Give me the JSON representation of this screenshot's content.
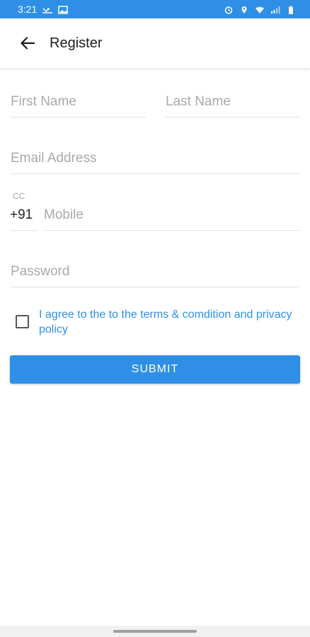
{
  "status_bar": {
    "time": "3:21",
    "left_icons": [
      "missed-call-icon",
      "image-icon"
    ],
    "right_icons": [
      "alarm-icon",
      "location-icon",
      "wifi-icon",
      "signal-icon",
      "battery-icon"
    ]
  },
  "app_bar": {
    "back_icon": "back-arrow-icon",
    "title": "Register"
  },
  "form": {
    "first_name": {
      "placeholder": "First Name",
      "value": ""
    },
    "last_name": {
      "placeholder": "Last Name",
      "value": ""
    },
    "email": {
      "placeholder": "Email Address",
      "value": ""
    },
    "country_code": {
      "label": "CC",
      "value": "+91"
    },
    "mobile": {
      "placeholder": "Mobile",
      "value": ""
    },
    "password": {
      "placeholder": "Password",
      "value": ""
    },
    "terms": {
      "checked": false,
      "text": "I agree to the to the terms & comdition and privacy policy"
    },
    "submit_label": "SUBMIT"
  },
  "colors": {
    "primary": "#2f8fe6",
    "placeholder": "#a9a9a9",
    "divider": "#e3e3e3"
  }
}
